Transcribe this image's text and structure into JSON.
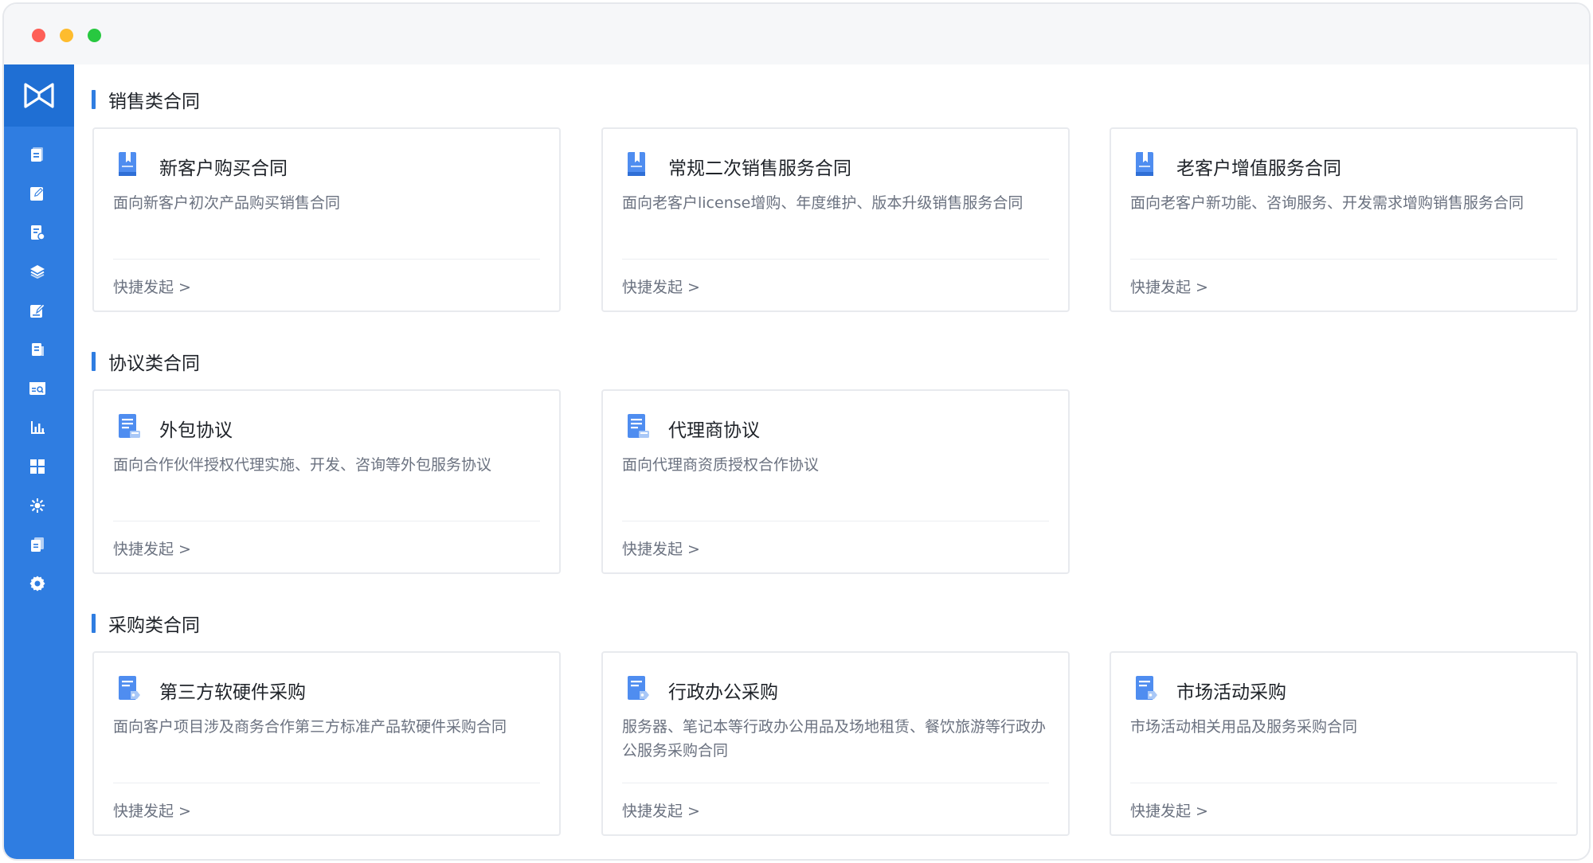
{
  "sections": [
    {
      "title": "销售类合同",
      "cards": [
        {
          "title": "新客户购买合同",
          "desc": "面向新客户初次产品购买销售合同",
          "action": "快捷发起 >"
        },
        {
          "title": "常规二次销售服务合同",
          "desc": "面向老客户license增购、年度维护、版本升级销售服务合同",
          "action": "快捷发起 >"
        },
        {
          "title": "老客户增值服务合同",
          "desc": "面向老客户新功能、咨询服务、开发需求增购销售服务合同",
          "action": "快捷发起 >"
        }
      ]
    },
    {
      "title": "协议类合同",
      "cards": [
        {
          "title": "外包协议",
          "desc": "面向合作伙伴授权代理实施、开发、咨询等外包服务协议",
          "action": "快捷发起 >"
        },
        {
          "title": "代理商协议",
          "desc": "面向代理商资质授权合作协议",
          "action": "快捷发起 >"
        }
      ]
    },
    {
      "title": "采购类合同",
      "cards": [
        {
          "title": "第三方软硬件采购",
          "desc": "面向客户项目涉及商务合作第三方标准产品软硬件采购合同",
          "action": "快捷发起 >"
        },
        {
          "title": "行政办公采购",
          "desc": "服务器、笔记本等行政办公用品及场地租赁、餐饮旅游等行政办公服务采购合同",
          "action": "快捷发起 >"
        },
        {
          "title": "市场活动采购",
          "desc": "市场活动相关用品及服务采购合同",
          "action": "快捷发起 >"
        }
      ]
    }
  ],
  "sidebar": {
    "icons": [
      "document-icon",
      "edit-icon",
      "document-settings-icon",
      "layers-icon",
      "sign-icon",
      "file-icon",
      "search-document-icon",
      "bar-chart-icon",
      "grid-icon",
      "integration-icon",
      "copy-icon",
      "gear-icon"
    ]
  },
  "colors": {
    "accent": "#2f7de1",
    "sidebar": "#2f7de1",
    "logo_bg": "#1f6fd4",
    "card_border": "#e8eaee",
    "muted_text": "#6b7280"
  }
}
